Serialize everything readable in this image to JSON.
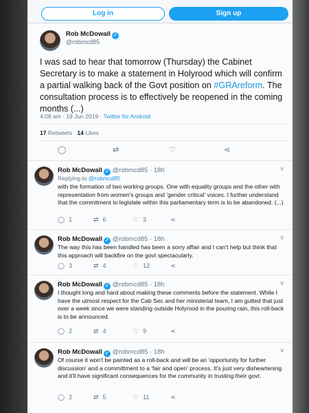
{
  "auth": {
    "login_label": "Log in",
    "signup_label": "Sign up"
  },
  "main_tweet": {
    "author_name": "Rob McDowall",
    "author_handle": "@robmcd85",
    "text_part1": "I was sad to hear that tomorrow (Thursday) the Cabinet Secretary is to make a statement in Holyrood which will confirm a partial walking back of the Govt position on ",
    "hashtag": "#GRAreform",
    "text_part2": ". The consultation process is to effectively be reopened in the coming months (...)",
    "time": "4:08 am · 19 Jun 2019 · ",
    "client": "Twitter for Android",
    "retweets_count": "17",
    "retweets_label": "Retweets",
    "likes_count": "14",
    "likes_label": "Likes"
  },
  "replies": [
    {
      "name": "Rob McDowall",
      "meta": "@robmcd85 · 18h",
      "replying_prefix": "Replying to ",
      "replying_handle": "@robmcd85",
      "text": "with the formation of two working groups. One with equality groups and the other with representation from women's groups and 'gender critical' voices. I further understand that the commitment to legislate within this parliamentary term is to be abandoned. (...)",
      "replies": "1",
      "retweets": "6",
      "likes": "3"
    },
    {
      "name": "Rob McDowall",
      "meta": "@robmcd85 · 18h",
      "text": "The way this has been handled has been a sorry affair and I can't help but think that this approach will backfire on the govt spectacularly.",
      "replies": "3",
      "retweets": "4",
      "likes": "12"
    },
    {
      "name": "Rob McDowall",
      "meta": "@robmcd85 · 18h",
      "text": "I thought long and hard about making these comments before the statement. While I have the utmost respect for the Cab Sec and her ministerial team, I am gutted that just over a week since we were standing outside Holyrood in the pouring rain, this roll-back is to be announced.",
      "replies": "2",
      "retweets": "4",
      "likes": "9"
    },
    {
      "name": "Rob McDowall",
      "meta": "@robmcd85 · 18h",
      "text": "Of course it won't be painted as a roll-back and will be an 'opportunity for further discussion' and a committment to a 'fair and open' process. It's just very disheartening and it'll have significant consequences for the community in trusting their govt.",
      "replies": "2",
      "retweets": "5",
      "likes": "11"
    }
  ]
}
